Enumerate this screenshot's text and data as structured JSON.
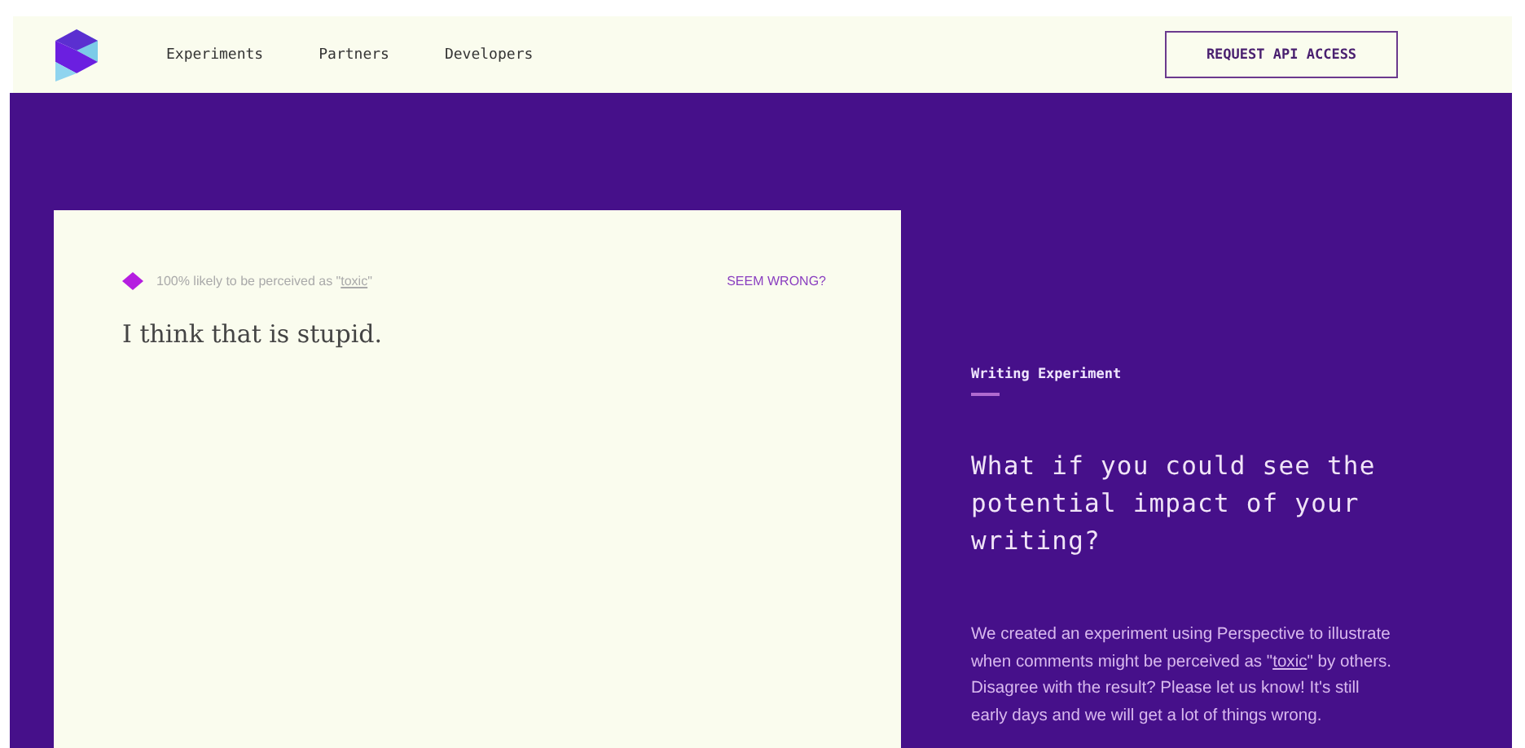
{
  "nav": {
    "links": [
      "Experiments",
      "Partners",
      "Developers"
    ],
    "cta": "REQUEST API ACCESS"
  },
  "card": {
    "score": {
      "before": "100% likely to be perceived as \"",
      "link": "toxic",
      "after": "\""
    },
    "action": "SEEM WRONG?",
    "comment": "I think that is stupid."
  },
  "aside": {
    "eyebrow": "Writing Experiment",
    "heading": "What if you could see the potential impact of your writing?",
    "body": {
      "before": "We created an experiment using Perspective to illustrate when comments might be perceived as \"",
      "link": "toxic",
      "after": "\" by others. Disagree with the result? Please let us know! It's still early days and we will get a lot of things wrong."
    }
  }
}
